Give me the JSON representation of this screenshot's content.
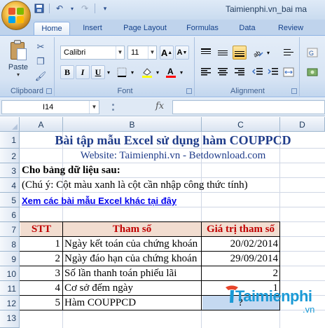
{
  "window": {
    "title": "Taimienphi.vn_bai ma"
  },
  "tabs": [
    {
      "label": "Home"
    },
    {
      "label": "Insert"
    },
    {
      "label": "Page Layout"
    },
    {
      "label": "Formulas"
    },
    {
      "label": "Data"
    },
    {
      "label": "Review"
    }
  ],
  "ribbon": {
    "clipboard": {
      "paste_label": "Paste",
      "group_label": "Clipboard"
    },
    "font": {
      "font_name": "Calibri",
      "font_size": "11",
      "group_label": "Font",
      "bold": "B",
      "italic": "I",
      "underline": "U"
    },
    "alignment": {
      "group_label": "Alignment"
    }
  },
  "formula_bar": {
    "name_box": "I14",
    "fx_label": "fx",
    "content": ""
  },
  "columns": [
    "A",
    "B",
    "C",
    "D"
  ],
  "rows": [
    "1",
    "2",
    "3",
    "4",
    "5",
    "6",
    "7",
    "8",
    "9",
    "10",
    "11",
    "12",
    "13"
  ],
  "sheet": {
    "title": "Bài tập mẫu Excel sử dụng hàm COUPPCD",
    "website": "Website: Taimienphi.vn - Betdownload.com",
    "intro": "Cho bảng dữ liệu sau:",
    "note": "(Chú ý: Cột màu xanh là cột cần nhập công thức tính)",
    "link": "Xem các bài mẫu Excel khác tại đây",
    "table": {
      "headers": [
        "STT",
        "Tham số",
        "Giá trị tham số"
      ],
      "rows": [
        {
          "stt": "1",
          "param": "Ngày kết toán của chứng khoán",
          "value": "20/02/2014"
        },
        {
          "stt": "2",
          "param": "Ngày đáo hạn của chứng khoán",
          "value": "29/09/2014"
        },
        {
          "stt": "3",
          "param": "Số lần thanh toán phiếu lãi",
          "value": "2"
        },
        {
          "stt": "4",
          "param": "Cơ sở đếm ngày",
          "value": "1"
        },
        {
          "stt": "5",
          "param": "Hàm COUPPCD",
          "value": "?"
        }
      ]
    }
  },
  "watermark": {
    "brand": "Taimienphi",
    "suffix": ".vn"
  },
  "colors": {
    "title_blue": "#1f3c8a",
    "header_red": "#c00000",
    "header_bg": "#f2ddd0",
    "formula_cell_blue": "#c5d9f1"
  }
}
